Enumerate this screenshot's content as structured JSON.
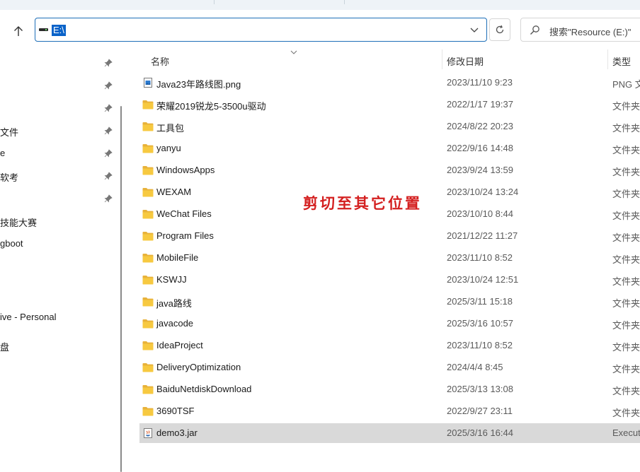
{
  "address_bar": {
    "path": "E:\\"
  },
  "search": {
    "placeholder": "搜索\"Resource (E:)\""
  },
  "sidebar": {
    "items": [
      {
        "label": ""
      },
      {
        "label": ""
      },
      {
        "label": ""
      },
      {
        "label": "文件"
      },
      {
        "label": "e"
      },
      {
        "label": "软考"
      },
      {
        "label": ""
      },
      {
        "label": "技能大赛"
      },
      {
        "label": "gboot"
      },
      {
        "label": "ive - Personal"
      },
      {
        "label": "盘"
      }
    ]
  },
  "columns": {
    "name": "名称",
    "date": "修改日期",
    "type": "类型"
  },
  "files": [
    {
      "name": "Java23年路线图.png",
      "date": "2023/11/10 9:23",
      "type": "PNG 文",
      "icon": "image-file-icon"
    },
    {
      "name": "荣耀2019锐龙5-3500u驱动",
      "date": "2022/1/17 19:37",
      "type": "文件夹",
      "icon": "folder-icon"
    },
    {
      "name": "工具包",
      "date": "2024/8/22 20:23",
      "type": "文件夹",
      "icon": "folder-icon"
    },
    {
      "name": "yanyu",
      "date": "2022/9/16 14:48",
      "type": "文件夹",
      "icon": "folder-icon"
    },
    {
      "name": "WindowsApps",
      "date": "2023/9/24 13:59",
      "type": "文件夹",
      "icon": "folder-icon"
    },
    {
      "name": "WEXAM",
      "date": "2023/10/24 13:24",
      "type": "文件夹",
      "icon": "folder-icon"
    },
    {
      "name": "WeChat Files",
      "date": "2023/10/10 8:44",
      "type": "文件夹",
      "icon": "folder-icon"
    },
    {
      "name": "Program Files",
      "date": "2021/12/22 11:27",
      "type": "文件夹",
      "icon": "folder-icon"
    },
    {
      "name": "MobileFile",
      "date": "2023/11/10 8:52",
      "type": "文件夹",
      "icon": "folder-icon"
    },
    {
      "name": "KSWJJ",
      "date": "2023/10/24 12:51",
      "type": "文件夹",
      "icon": "folder-icon"
    },
    {
      "name": "java路线",
      "date": "2025/3/11 15:18",
      "type": "文件夹",
      "icon": "folder-icon"
    },
    {
      "name": "javacode",
      "date": "2025/3/16 10:57",
      "type": "文件夹",
      "icon": "folder-icon"
    },
    {
      "name": "IdeaProject",
      "date": "2023/11/10 8:52",
      "type": "文件夹",
      "icon": "folder-icon"
    },
    {
      "name": "DeliveryOptimization",
      "date": "2024/4/4 8:45",
      "type": "文件夹",
      "icon": "folder-icon"
    },
    {
      "name": "BaiduNetdiskDownload",
      "date": "2025/3/13 13:08",
      "type": "文件夹",
      "icon": "folder-icon"
    },
    {
      "name": "3690TSF",
      "date": "2022/9/27 23:11",
      "type": "文件夹",
      "icon": "folder-icon"
    },
    {
      "name": "demo3.jar",
      "date": "2025/3/16 16:44",
      "type": "Executa",
      "icon": "jar-file-icon",
      "selected": true
    }
  ],
  "overlay_note": "剪切至其它位置",
  "colors": {
    "accent": "#0a63c9",
    "folder": "#f7c940",
    "note": "#d42020",
    "selection": "#d9d9d9"
  }
}
